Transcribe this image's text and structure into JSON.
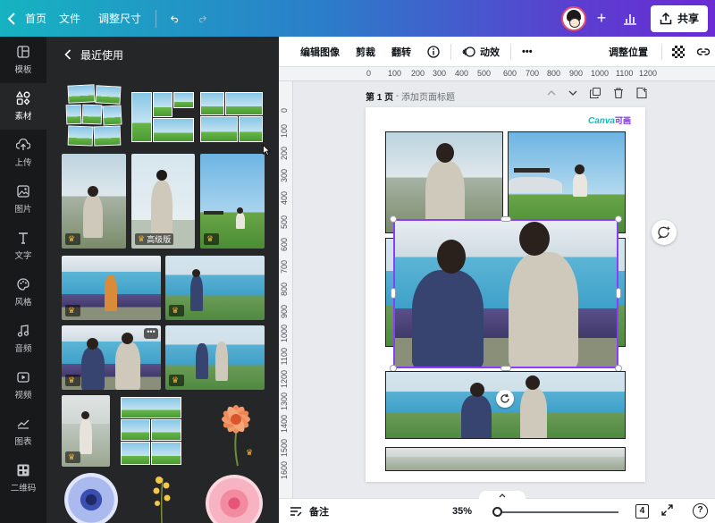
{
  "topbar": {
    "home": "首页",
    "file": "文件",
    "resize": "调整尺寸",
    "share": "共享"
  },
  "rail": [
    {
      "label": "模板",
      "icon": "template-icon"
    },
    {
      "label": "素材",
      "icon": "elements-icon"
    },
    {
      "label": "上传",
      "icon": "upload-icon"
    },
    {
      "label": "图片",
      "icon": "photo-icon"
    },
    {
      "label": "文字",
      "icon": "text-icon"
    },
    {
      "label": "风格",
      "icon": "palette-icon"
    },
    {
      "label": "音频",
      "icon": "audio-icon"
    },
    {
      "label": "视频",
      "icon": "video-icon"
    },
    {
      "label": "图表",
      "icon": "chart-icon"
    },
    {
      "label": "二维码",
      "icon": "qr-icon"
    }
  ],
  "panel": {
    "title": "最近使用",
    "premium_label": "高级版"
  },
  "editbar": {
    "edit_image": "编辑图像",
    "crop": "剪裁",
    "flip": "翻转",
    "animate": "动效",
    "more": "•••",
    "position": "调整位置"
  },
  "ruler": {
    "h": [
      "0",
      "100",
      "200",
      "300",
      "400",
      "500",
      "600",
      "700",
      "800",
      "900",
      "1000",
      "1100",
      "1200"
    ],
    "v": [
      "0",
      "100",
      "200",
      "300",
      "400",
      "500",
      "600",
      "700",
      "800",
      "900",
      "1000",
      "1100",
      "1200",
      "1300",
      "1400",
      "1500",
      "1600"
    ]
  },
  "page": {
    "label": "第 1 页",
    "separator": " - ",
    "title_placeholder": "添加页面标题",
    "brand": "Canva",
    "brand_cn": "可画"
  },
  "bottombar": {
    "notes": "备注",
    "zoom": "35%",
    "page_count": "4",
    "help": "?"
  },
  "colors": {
    "accent_purple": "#8b3dff",
    "canva_teal": "#00c4cc",
    "panel_bg": "#252627",
    "rail_bg": "#18191b"
  }
}
